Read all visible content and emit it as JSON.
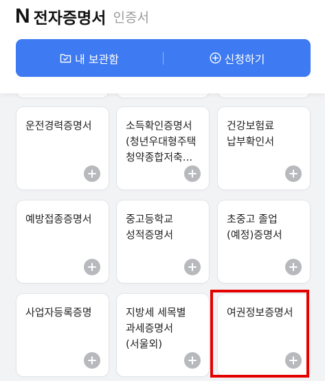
{
  "header": {
    "logo": "N",
    "title": "전자증명서",
    "subtitle": "인증서"
  },
  "actions": {
    "my_box_label": "내 보관함",
    "apply_label": "신청하기"
  },
  "cards": [
    {
      "title": "운전경력증명서"
    },
    {
      "title": "소득확인증명서\n(청년우대형주택\n청약종합저축..."
    },
    {
      "title": "건강보험료\n납부확인서"
    },
    {
      "title": "예방접종증명서"
    },
    {
      "title": "중고등학교\n성적증명서"
    },
    {
      "title": "초중고 졸업\n(예정)증명서"
    },
    {
      "title": "사업자등록증명"
    },
    {
      "title": "지방세 세목별\n과세증명서\n(서울외)"
    },
    {
      "title": "여권정보증명서"
    }
  ],
  "colors": {
    "accent": "#3e7af1",
    "highlight": "#e50000",
    "plus_icon": "#b7b9bd"
  }
}
